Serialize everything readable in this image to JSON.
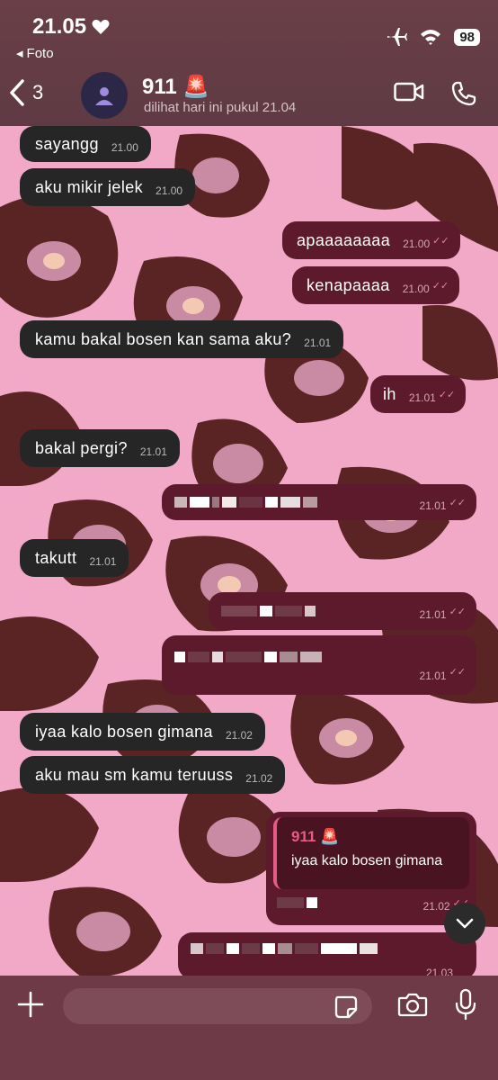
{
  "status": {
    "time": "21.05",
    "back_app": "Foto",
    "battery": "98"
  },
  "header": {
    "back_count": "3",
    "title": "911 🚨",
    "subtitle": "dilihat hari ini pukul 21.04"
  },
  "messages": [
    {
      "dir": "in",
      "text": "sayangg",
      "time": "21.00"
    },
    {
      "dir": "in",
      "text": "aku mikir jelek",
      "time": "21.00"
    },
    {
      "dir": "out",
      "text": "apaaaaaaaa",
      "time": "21.00"
    },
    {
      "dir": "out",
      "text": "kenapaaaa",
      "time": "21.00"
    },
    {
      "dir": "in",
      "text": "kamu bakal bosen kan sama aku?",
      "time": "21.01"
    },
    {
      "dir": "out",
      "text": "ih",
      "time": "21.01"
    },
    {
      "dir": "in",
      "text": "bakal pergi?",
      "time": "21.01"
    },
    {
      "dir": "out",
      "text": "",
      "time": "21.01"
    },
    {
      "dir": "in",
      "text": "takutt",
      "time": "21.01"
    },
    {
      "dir": "out",
      "text": "",
      "time": "21.01"
    },
    {
      "dir": "out",
      "text": "",
      "time": "21.01"
    },
    {
      "dir": "in",
      "text": "iyaa kalo bosen gimana",
      "time": "21.02"
    },
    {
      "dir": "in",
      "text": "aku mau sm kamu teruuss",
      "time": "21.02"
    },
    {
      "dir": "out",
      "text": "",
      "time": "21.02",
      "reply_to": {
        "name": "911 🚨",
        "text": "iyaa kalo bosen gimana"
      }
    },
    {
      "dir": "out",
      "text": "",
      "time": "21.03"
    }
  ],
  "colors": {
    "incoming_bubble": "#262626",
    "outgoing_bubble": "#5e1a2d",
    "wallpaper_pink": "#f1a9c7",
    "reply_accent": "#e65a86"
  },
  "icons": [
    "heart-icon",
    "airplane-icon",
    "wifi-icon",
    "back-chevron-icon",
    "person-icon",
    "video-call-icon",
    "phone-icon",
    "plus-icon",
    "sticker-icon",
    "camera-icon",
    "mic-icon",
    "chevron-down-icon"
  ]
}
